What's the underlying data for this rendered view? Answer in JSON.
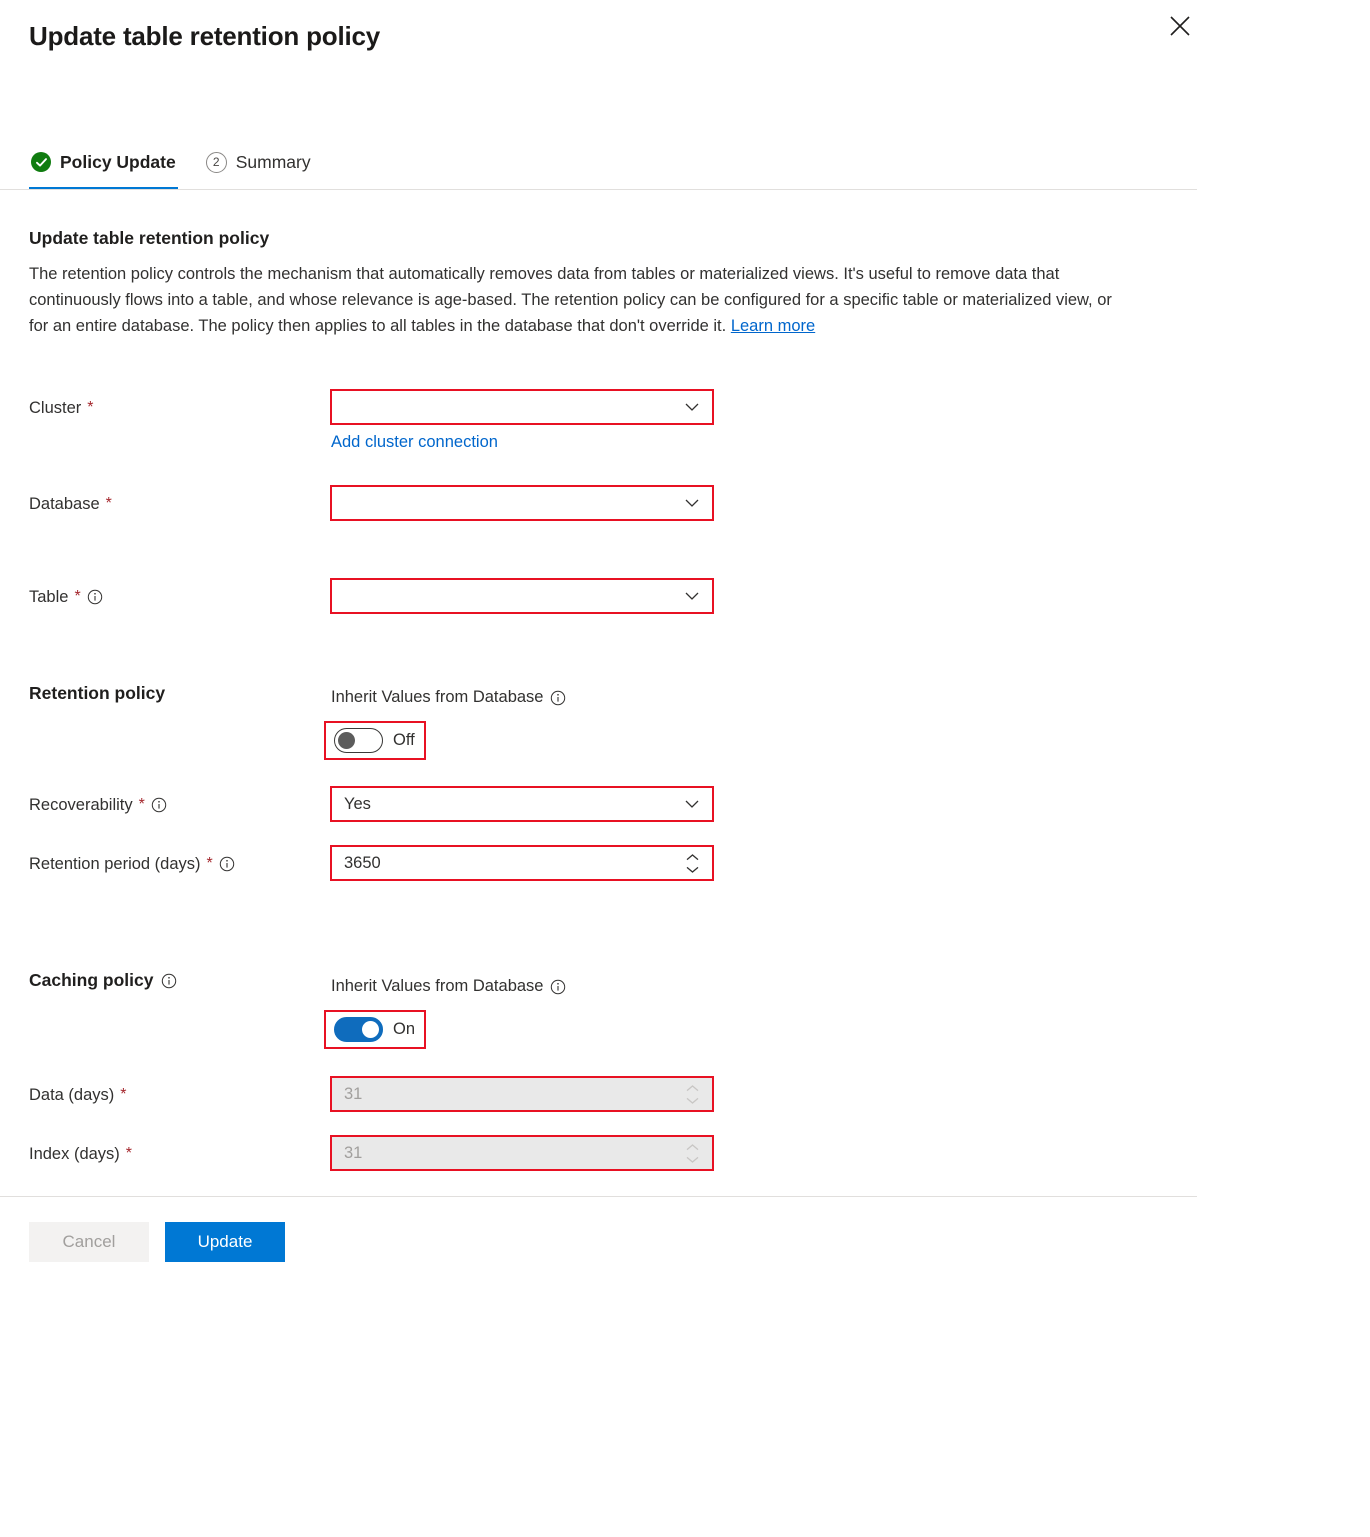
{
  "window": {
    "title": "Update table retention policy",
    "close_icon": "close-icon"
  },
  "tabs": [
    {
      "label": "Policy Update",
      "state": "completed",
      "marker": "check"
    },
    {
      "label": "Summary",
      "state": "pending",
      "marker": "2"
    }
  ],
  "section": {
    "heading": "Update table retention policy",
    "description": "The retention policy controls the mechanism that automatically removes data from tables or materialized views. It's useful to remove data that continuously flows into a table, and whose relevance is age-based. The retention policy can be configured for a specific table or materialized view, or for an entire database. The policy then applies to all tables in the database that don't override it. ",
    "learn_more": "Learn more"
  },
  "form": {
    "cluster": {
      "label": "Cluster",
      "required": "*",
      "value": "",
      "placeholder": "",
      "add_connection_link": "Add cluster connection"
    },
    "database": {
      "label": "Database",
      "required": "*",
      "value": "",
      "placeholder": ""
    },
    "table": {
      "label": "Table",
      "required": "*",
      "value": "",
      "placeholder": "",
      "info": "info-icon"
    }
  },
  "retention_policy": {
    "title": "Retention policy",
    "inherit_label": "Inherit Values from Database",
    "inherit_state": "Off",
    "inherit_on": false,
    "recoverability": {
      "label": "Recoverability",
      "required": "*",
      "value": "Yes"
    },
    "retention_period": {
      "label": "Retention period (days)",
      "required": "*",
      "value": "3650"
    }
  },
  "caching_policy": {
    "title": "Caching policy",
    "inherit_label": "Inherit Values from Database",
    "inherit_state": "On",
    "inherit_on": true,
    "data_days": {
      "label": "Data (days)",
      "required": "*",
      "value": "31",
      "disabled": true
    },
    "index_days": {
      "label": "Index (days)",
      "required": "*",
      "value": "31",
      "disabled": true
    }
  },
  "footer": {
    "cancel_label": "Cancel",
    "update_label": "Update"
  },
  "colors": {
    "accent": "#0078d4",
    "toggle_on": "#0f6cbd",
    "validation_outline": "#e81123",
    "required_asterisk": "#a4262c",
    "step_complete": "#107c10",
    "link": "#0066cc"
  }
}
